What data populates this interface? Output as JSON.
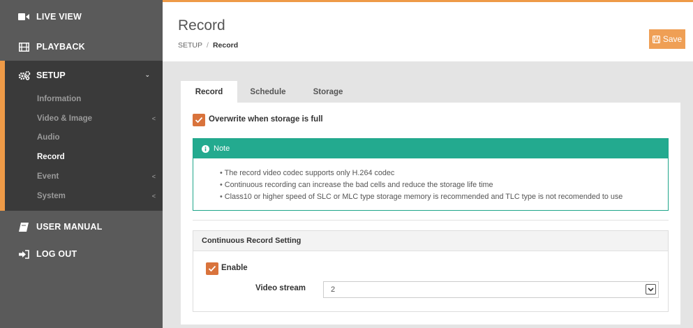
{
  "colors": {
    "accent": "#ee9a47",
    "note_green": "#23aa8f",
    "checkbox": "#d9733c",
    "sidebar": "#5a5a5a"
  },
  "sidebar": {
    "live_view": "LIVE VIEW",
    "playback": "PLAYBACK",
    "setup": "SETUP",
    "setup_items": [
      {
        "label": "Information"
      },
      {
        "label": "Video & Image"
      },
      {
        "label": "Audio"
      },
      {
        "label": "Record"
      },
      {
        "label": "Event"
      },
      {
        "label": "System"
      }
    ],
    "user_manual": "USER MANUAL",
    "log_out": "LOG OUT"
  },
  "header": {
    "title": "Record",
    "breadcrumb_root": "SETUP",
    "breadcrumb_sep": "/",
    "breadcrumb_current": "Record",
    "save_label": "Save"
  },
  "tabs": [
    {
      "label": "Record"
    },
    {
      "label": "Schedule"
    },
    {
      "label": "Storage"
    }
  ],
  "overwrite": {
    "label": "Overwrite when storage is full",
    "checked": true
  },
  "note": {
    "title": "Note",
    "lines": [
      "The record video codec supports only H.264 codec",
      "Continuous recording can increase the bad cells and reduce the storage life time",
      "Class10 or higher speed of SLC or MLC type storage memory is recommended and TLC type is not recomended to use"
    ]
  },
  "continuous": {
    "title": "Continuous Record Setting",
    "enable_label": "Enable",
    "enable_checked": true,
    "video_stream_label": "Video stream",
    "video_stream_value": "2"
  }
}
